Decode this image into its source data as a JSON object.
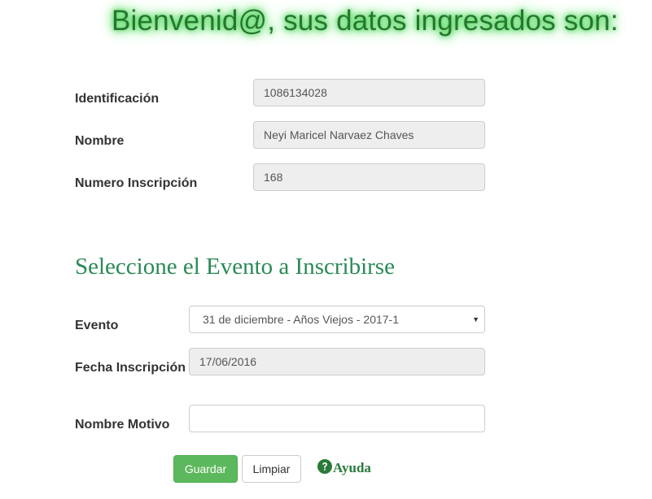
{
  "header": {
    "welcome": "Bienvenid@, sus datos ingresados son:"
  },
  "user": {
    "id_label": "Identificación",
    "id_value": "1086134028",
    "name_label": "Nombre",
    "name_value": "Neyi  Maricel Narvaez Chaves",
    "registration_label": "Numero Inscripción",
    "registration_value": "168"
  },
  "event_section": {
    "title": "Seleccione el Evento a Inscribirse",
    "event_label": "Evento",
    "event_selected": "31 de diciembre - Años Viejos - 2017-1",
    "date_label": "Fecha Inscripción",
    "date_value": "17/06/2016",
    "motive_label": "Nombre Motivo",
    "motive_value": ""
  },
  "actions": {
    "save_label": "Guardar",
    "clear_label": "Limpiar",
    "help_label": "Ayuda"
  },
  "icons": {
    "help": "question-circle-icon",
    "select": "caret-down-icon"
  },
  "colors": {
    "welcome": "#26762f",
    "section_title": "#2a8a57",
    "save_button": "#5cb85c",
    "help": "#2a7a3a",
    "readonly_field": "#eeeeee"
  }
}
